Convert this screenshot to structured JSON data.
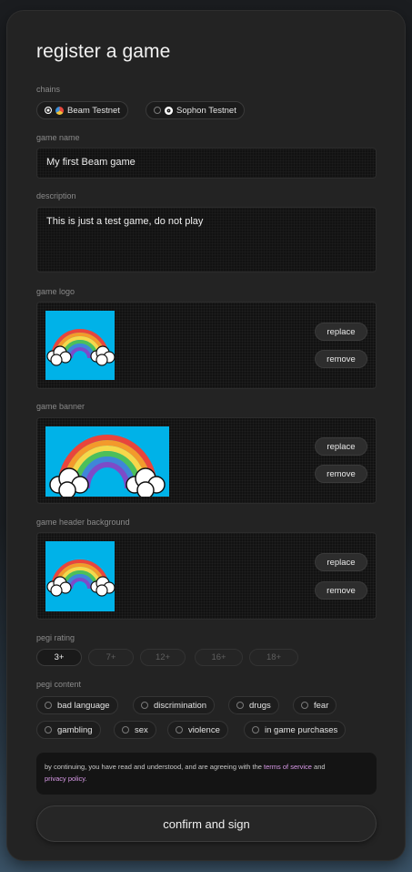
{
  "title": "register a game",
  "chains": {
    "label": "chains",
    "items": [
      {
        "name": "Beam Testnet",
        "selected": true,
        "icon": "beam-logo-icon"
      },
      {
        "name": "Sophon Testnet",
        "selected": false,
        "icon": "sophon-logo-icon"
      }
    ]
  },
  "game_name": {
    "label": "game name",
    "value": "My first Beam game"
  },
  "description": {
    "label": "description",
    "value": "This is just a test game, do not play"
  },
  "game_logo": {
    "label": "game logo",
    "replace": "replace",
    "remove": "remove"
  },
  "game_banner": {
    "label": "game banner",
    "replace": "replace",
    "remove": "remove"
  },
  "game_header": {
    "label": "game header background",
    "replace": "replace",
    "remove": "remove"
  },
  "pegi_rating": {
    "label": "pegi rating",
    "options": [
      "3+",
      "7+",
      "12+",
      "16+",
      "18+"
    ],
    "selected": "3+"
  },
  "pegi_content": {
    "label": "pegi content",
    "items": [
      "bad language",
      "discrimination",
      "drugs",
      "fear",
      "gambling",
      "sex",
      "violence",
      "in game purchases"
    ]
  },
  "notice": {
    "text_before": "by continuing, you have read and understood, and are agreeing with the ",
    "terms": "terms of service",
    "and": " and",
    "privacy": "privacy policy",
    "end": "."
  },
  "confirm_label": "confirm and sign",
  "colors": {
    "image_sky": "#00b2e8",
    "link": "#d99ae8"
  }
}
